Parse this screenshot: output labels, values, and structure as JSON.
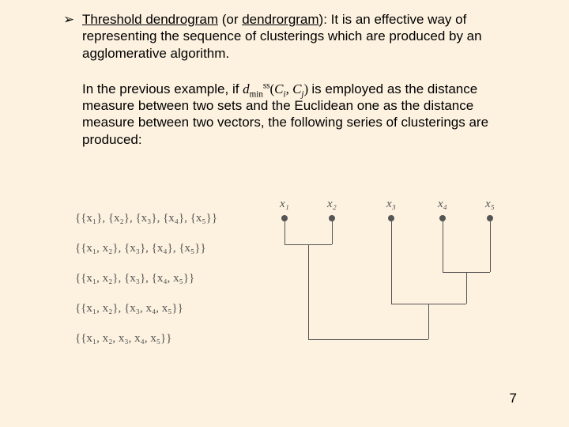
{
  "bullet": {
    "glyph": "➢",
    "term1": "Threshold dendrogram",
    "between": " (or ",
    "term2": "dendrorgram",
    "after_terms": "): It is an effective way of representing the sequence of clusterings which are produced by an agglomerative algorithm."
  },
  "paragraph": {
    "pre": "In the previous example, if ",
    "d": "d",
    "sub1": "min",
    "sup1": "ss",
    "open": "(",
    "C1": "C",
    "C1sub": "i",
    "comma": ", ",
    "C2": "C",
    "C2sub": "j",
    "close": ")",
    "post": " is employed as the distance measure between two sets and the Euclidean one as the distance measure between two vectors, the following series of clusterings are produced:"
  },
  "clusterings": [
    "{{x₁}, {x₂}, {x₃}, {x₄}, {x₅}}",
    "{{x₁, x₂}, {x₃}, {x₄}, {x₅}}",
    "{{x₁, x₂}, {x₃}, {x₄, x₅}}",
    "{{x₁, x₂}, {x₃, x₄, x₅}}",
    "{{x₁, x₂, x₃, x₄, x₅}}"
  ],
  "leaves": [
    "x₁",
    "x₂",
    "x₃",
    "x₄",
    "x₅"
  ],
  "page_number": "7",
  "chart_data": {
    "type": "dendrogram",
    "leaves": [
      "x1",
      "x2",
      "x3",
      "x4",
      "x5"
    ],
    "leaf_x": [
      15,
      75,
      150,
      215,
      275
    ],
    "leaf_y": 22,
    "merges": [
      {
        "members": [
          "x1",
          "x2"
        ],
        "height": 55,
        "x_range": [
          15,
          75
        ],
        "mid": 45
      },
      {
        "members": [
          "x4",
          "x5"
        ],
        "height": 90,
        "x_range": [
          215,
          275
        ],
        "mid": 245
      },
      {
        "members": [
          "x3",
          "(x4,x5)"
        ],
        "height": 130,
        "x_range": [
          150,
          245
        ],
        "mid": 197
      },
      {
        "members": [
          "(x1,x2)",
          "(x3,x4,x5)"
        ],
        "height": 175,
        "x_range": [
          45,
          197
        ],
        "mid": 121
      }
    ]
  }
}
